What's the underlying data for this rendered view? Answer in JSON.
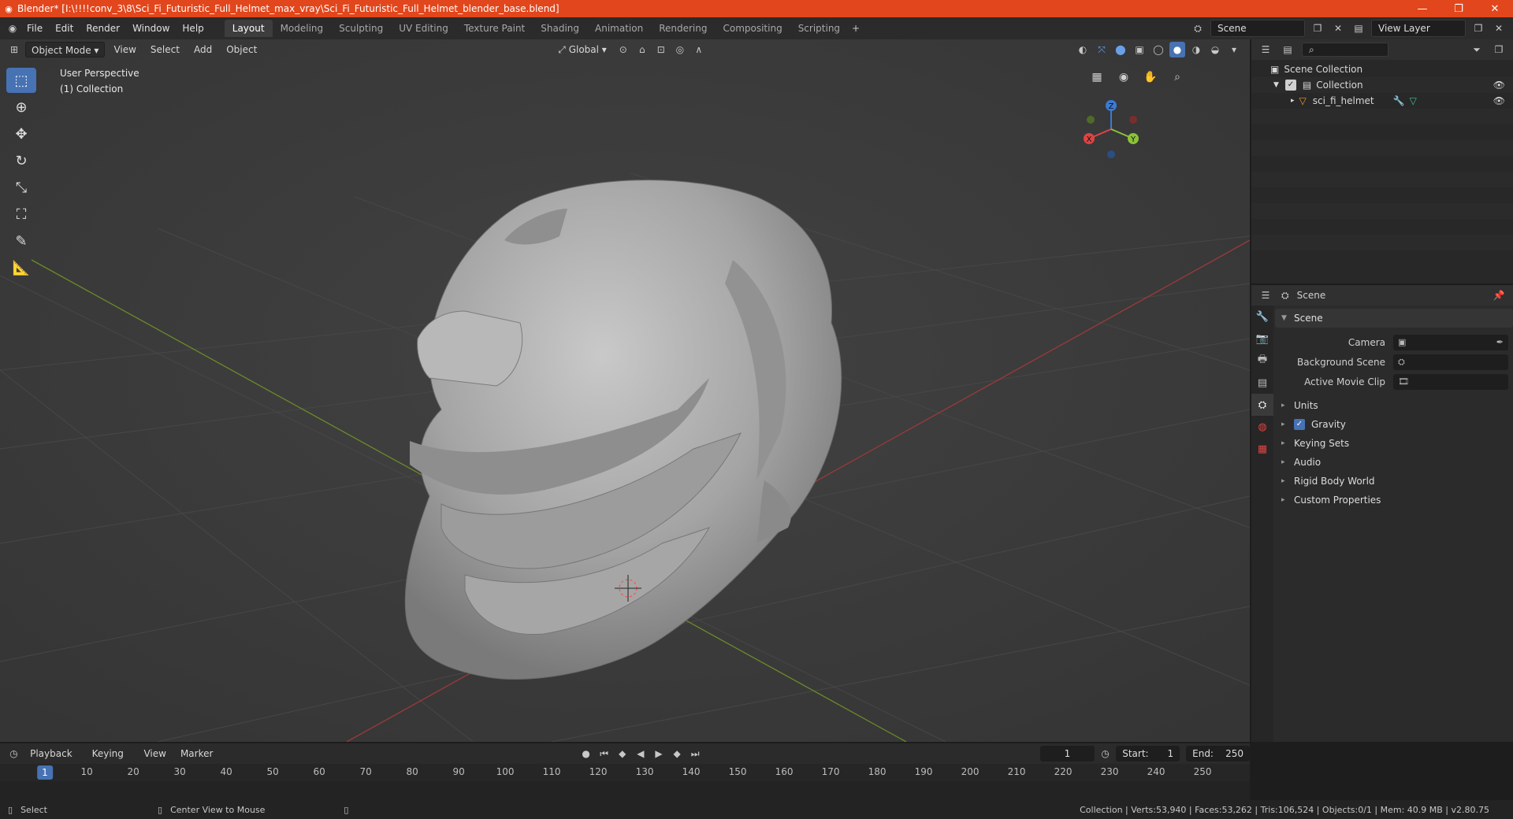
{
  "window": {
    "title": "Blender* [I:\\!!!!conv_3\\8\\Sci_Fi_Futuristic_Full_Helmet_max_vray\\Sci_Fi_Futuristic_Full_Helmet_blender_base.blend]",
    "accent": "#e2461c"
  },
  "menu": [
    "File",
    "Edit",
    "Render",
    "Window",
    "Help"
  ],
  "workspaces": [
    "Layout",
    "Modeling",
    "Sculpting",
    "UV Editing",
    "Texture Paint",
    "Shading",
    "Animation",
    "Rendering",
    "Compositing",
    "Scripting"
  ],
  "active_workspace": "Layout",
  "scene_field": "Scene",
  "view_layer_field": "View Layer",
  "viewport": {
    "mode": "Object Mode",
    "menus": [
      "View",
      "Select",
      "Add",
      "Object"
    ],
    "orientation": "Global",
    "info_line1": "User Perspective",
    "info_line2": "(1) Collection",
    "gizmo": {
      "x": "X",
      "y": "Y",
      "z": "Z"
    }
  },
  "outliner": {
    "root": "Scene Collection",
    "collection": "Collection",
    "object": "sci_fi_helmet"
  },
  "properties": {
    "header": "Scene",
    "panel": "Scene",
    "rows": [
      {
        "label": "Camera"
      },
      {
        "label": "Background Scene"
      },
      {
        "label": "Active Movie Clip"
      }
    ],
    "subpanels": [
      "Units",
      "Gravity",
      "Keying Sets",
      "Audio",
      "Rigid Body World",
      "Custom Properties"
    ]
  },
  "timeline": {
    "menus": [
      "Playback",
      "Keying",
      "View",
      "Marker"
    ],
    "current_frame": "1",
    "start_label": "Start:",
    "start": "1",
    "end_label": "End:",
    "end": "250",
    "ticks": [
      "10",
      "20",
      "30",
      "40",
      "50",
      "60",
      "70",
      "80",
      "90",
      "100",
      "110",
      "120",
      "130",
      "140",
      "150",
      "160",
      "170",
      "180",
      "190",
      "200",
      "210",
      "220",
      "230",
      "240",
      "250"
    ],
    "cursor": "1"
  },
  "status": {
    "left1": "Select",
    "left2": "Center View to Mouse",
    "right": "Collection | Verts:53,940 | Faces:53,262 | Tris:106,524 | Objects:0/1 | Mem: 40.9 MB | v2.80.75"
  }
}
